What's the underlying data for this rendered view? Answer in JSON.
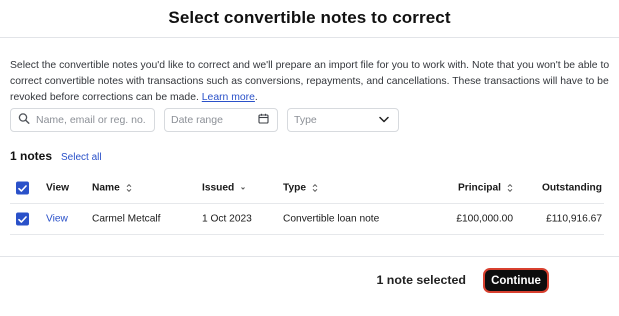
{
  "header": {
    "title": "Select convertible notes to correct"
  },
  "description": {
    "text": "Select the convertible notes you'd like to correct and we'll prepare an import file for you to work with. Note that you won't be able to correct convertible notes with transactions such as conversions, repayments, and cancellations. These transactions will have to be revoked before corrections can be made. ",
    "link": "Learn more",
    "after": "."
  },
  "filters": {
    "search_placeholder": "Name, email or reg. no.",
    "date_placeholder": "Date range",
    "type_placeholder": "Type"
  },
  "summary": {
    "count": "1 notes",
    "select_all": "Select all"
  },
  "table": {
    "columns": {
      "view": "View",
      "name": "Name",
      "issued": "Issued",
      "type": "Type",
      "principal": "Principal",
      "outstanding": "Outstanding"
    },
    "rows": [
      {
        "checked": true,
        "view": "View",
        "name": "Carmel Metcalf",
        "issued": "1 Oct 2023",
        "type": "Convertible loan note",
        "principal": "£100,000.00",
        "outstanding": "£110,916.67"
      }
    ]
  },
  "footer": {
    "selected_text": "1 note selected",
    "continue_label": "Continue"
  },
  "colors": {
    "accent": "#2a51c9",
    "button_bg": "#0d0d0d",
    "button_outline": "#d8402f"
  },
  "icons": {
    "search": "search-icon",
    "calendar": "calendar-icon",
    "dropdown": "chevron-down-icon",
    "sort": "sort-icon",
    "sort_desc": "sort-desc-icon",
    "checkbox": "checkbox-checked-icon"
  }
}
